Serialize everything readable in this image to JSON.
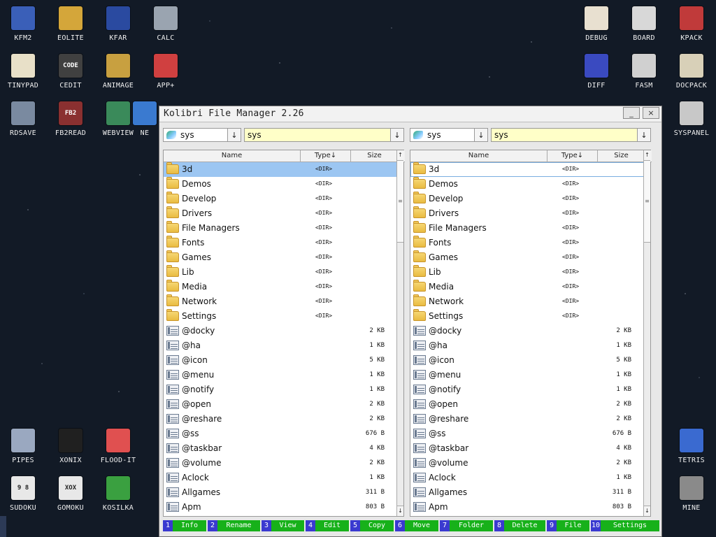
{
  "desktop": {
    "icons": [
      {
        "label": "KFM2",
        "color": "#3a5fb8",
        "glyph": "floppy-disk-icon"
      },
      {
        "label": "EOLITE",
        "color": "#d4a63a",
        "glyph": "folder-icon"
      },
      {
        "label": "KFAR",
        "color": "#2a4aa0",
        "glyph": "kfar-icon"
      },
      {
        "label": "CALC",
        "color": "#9aa4b0",
        "glyph": "calculator-icon"
      },
      {
        "label": "TINYPAD",
        "color": "#e8e0c8",
        "glyph": "notepad-icon"
      },
      {
        "label": "CEDIT",
        "color": "#404040",
        "glyph": "code-icon",
        "text": "CODE"
      },
      {
        "label": "ANIMAGE",
        "color": "#c8a040",
        "glyph": "pencil-icon"
      },
      {
        "label": "APP+",
        "color": "#d04040",
        "glyph": "rubik-cube-icon"
      },
      {
        "label": "RDSAVE",
        "color": "#7a8aa0",
        "glyph": "ramdisk-save-icon"
      },
      {
        "label": "FB2READ",
        "color": "#8a3030",
        "glyph": "book-icon",
        "text": "FB2"
      },
      {
        "label": "WEBVIEW",
        "color": "#3a8a5a",
        "glyph": "globe-icon"
      },
      {
        "label": "NE",
        "color": "#3a7ad0",
        "glyph": "network-icon"
      },
      {
        "label": "DEBUG",
        "color": "#e8e0d0",
        "glyph": "bug-icon"
      },
      {
        "label": "BOARD",
        "color": "#d8d8d8",
        "glyph": "board-icon"
      },
      {
        "label": "KPACK",
        "color": "#c03a3a",
        "glyph": "wrench-icon"
      },
      {
        "label": "DIFF",
        "color": "#3a4ac0",
        "glyph": "diff-icon"
      },
      {
        "label": "FASM",
        "color": "#d0d0d0",
        "glyph": "fasm-icon"
      },
      {
        "label": "DOCPACK",
        "color": "#d8d0b8",
        "glyph": "cabinet-icon"
      },
      {
        "label": "SYSPANEL",
        "color": "#c8c8c8",
        "glyph": "sliders-icon"
      },
      {
        "label": "PIPES",
        "color": "#9aa8c0",
        "glyph": "pipes-icon"
      },
      {
        "label": "XONIX",
        "color": "#202020",
        "glyph": "xonix-icon"
      },
      {
        "label": "FLOOD-IT",
        "color": "#e05050",
        "glyph": "flood-it-icon"
      },
      {
        "label": "TETRIS",
        "color": "#3a6ad0",
        "glyph": "tetris-icon"
      },
      {
        "label": "SUDOKU",
        "color": "#e8e8e8",
        "glyph": "sudoku-icon",
        "text": "9 8\n2"
      },
      {
        "label": "GOMOKU",
        "color": "#e8e8e8",
        "glyph": "gomoku-icon",
        "text": "XOX"
      },
      {
        "label": "KOSILKA",
        "color": "#3aa040",
        "glyph": "lawnmower-icon"
      },
      {
        "label": "MINE",
        "color": "#8a8a8a",
        "glyph": "mine-icon"
      }
    ]
  },
  "window": {
    "title": "Kolibri File Manager 2.26",
    "minimize": "_",
    "close": "×"
  },
  "panels": {
    "left": {
      "drive": "sys",
      "path": "sys",
      "dropdown": "↓"
    },
    "right": {
      "drive": "sys",
      "path": "sys",
      "dropdown": "↓"
    }
  },
  "columns": {
    "name": "Name",
    "type": "Type↓",
    "size": "Size",
    "scroll_up": "↑",
    "scroll_down": "↓",
    "thumb": "≡"
  },
  "files": [
    {
      "name": "3d",
      "type": "<DIR>",
      "size": "",
      "kind": "folder"
    },
    {
      "name": "Demos",
      "type": "<DIR>",
      "size": "",
      "kind": "folder"
    },
    {
      "name": "Develop",
      "type": "<DIR>",
      "size": "",
      "kind": "folder"
    },
    {
      "name": "Drivers",
      "type": "<DIR>",
      "size": "",
      "kind": "folder"
    },
    {
      "name": "File Managers",
      "type": "<DIR>",
      "size": "",
      "kind": "folder"
    },
    {
      "name": "Fonts",
      "type": "<DIR>",
      "size": "",
      "kind": "folder"
    },
    {
      "name": "Games",
      "type": "<DIR>",
      "size": "",
      "kind": "folder"
    },
    {
      "name": "Lib",
      "type": "<DIR>",
      "size": "",
      "kind": "folder"
    },
    {
      "name": "Media",
      "type": "<DIR>",
      "size": "",
      "kind": "folder"
    },
    {
      "name": "Network",
      "type": "<DIR>",
      "size": "",
      "kind": "folder"
    },
    {
      "name": "Settings",
      "type": "<DIR>",
      "size": "",
      "kind": "folder"
    },
    {
      "name": "@docky",
      "type": "",
      "size": "2 KB",
      "kind": "file"
    },
    {
      "name": "@ha",
      "type": "",
      "size": "1 KB",
      "kind": "file"
    },
    {
      "name": "@icon",
      "type": "",
      "size": "5 KB",
      "kind": "file"
    },
    {
      "name": "@menu",
      "type": "",
      "size": "1 KB",
      "kind": "file"
    },
    {
      "name": "@notify",
      "type": "",
      "size": "1 KB",
      "kind": "file"
    },
    {
      "name": "@open",
      "type": "",
      "size": "2 KB",
      "kind": "file"
    },
    {
      "name": "@reshare",
      "type": "",
      "size": "2 KB",
      "kind": "file"
    },
    {
      "name": "@ss",
      "type": "",
      "size": "676 B",
      "kind": "file"
    },
    {
      "name": "@taskbar",
      "type": "",
      "size": "4 KB",
      "kind": "file"
    },
    {
      "name": "@volume",
      "type": "",
      "size": "2 KB",
      "kind": "file"
    },
    {
      "name": "Aclock",
      "type": "",
      "size": "1 KB",
      "kind": "file"
    },
    {
      "name": "Allgames",
      "type": "",
      "size": "311 B",
      "kind": "file"
    },
    {
      "name": "Apm",
      "type": "",
      "size": "803 B",
      "kind": "file"
    }
  ],
  "fkeys": [
    {
      "num": "1",
      "label": "Info"
    },
    {
      "num": "2",
      "label": "Rename"
    },
    {
      "num": "3",
      "label": "View"
    },
    {
      "num": "4",
      "label": "Edit"
    },
    {
      "num": "5",
      "label": "Copy"
    },
    {
      "num": "6",
      "label": "Move"
    },
    {
      "num": "7",
      "label": "Folder"
    },
    {
      "num": "8",
      "label": "Delete"
    },
    {
      "num": "9",
      "label": "File"
    },
    {
      "num": "10",
      "label": "Settings"
    }
  ]
}
